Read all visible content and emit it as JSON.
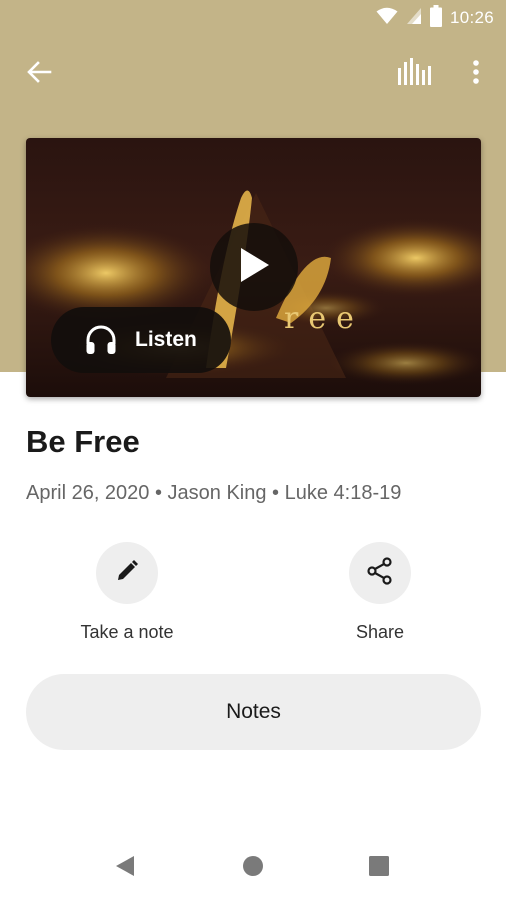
{
  "status_bar": {
    "time": "10:26",
    "icons": [
      "wifi-icon",
      "signal-icon",
      "battery-icon"
    ]
  },
  "app_bar": {
    "icons": [
      "back-arrow-icon",
      "equalizer-icon",
      "more-vert-icon"
    ]
  },
  "media": {
    "artwork_text": "be free",
    "listen_label": "Listen",
    "icons": [
      "play-icon",
      "headphones-icon"
    ]
  },
  "sermon": {
    "title": "Be Free",
    "meta": "April 26, 2020 • Jason King • Luke 4:18-19"
  },
  "actions": {
    "note_label": "Take a note",
    "share_label": "Share"
  },
  "notes_button": {
    "label": "Notes"
  },
  "nav_bar": {
    "icons": [
      "nav-back-icon",
      "nav-home-icon",
      "nav-recents-icon"
    ]
  },
  "colors": {
    "header": "#c3b488",
    "surface": "#eeeeee",
    "pill": "#120e0c",
    "text_primary": "#1a1a1a",
    "text_secondary": "#666666"
  }
}
